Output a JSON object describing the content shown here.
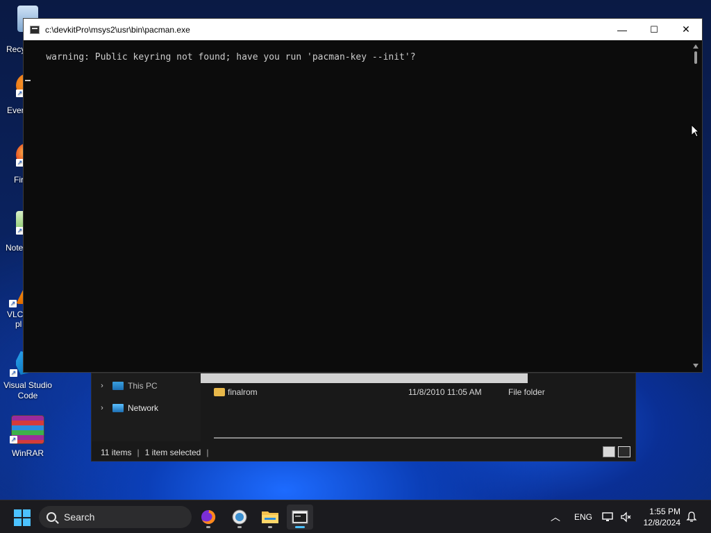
{
  "desktop": {
    "icons": [
      {
        "label": "Recy",
        "icon": "recycle-bin-icon"
      },
      {
        "label": "Ever",
        "icon": "everything-icon"
      },
      {
        "label": "Fir",
        "icon": "firefox-icon"
      },
      {
        "label": "Note",
        "icon": "notepad-plus-plus-icon"
      },
      {
        "label": "VLC",
        "label2": "pl",
        "icon": "vlc-icon"
      },
      {
        "label": "Visual Studio",
        "label2": "Code",
        "icon": "vscode-icon"
      },
      {
        "label": "WinRAR",
        "icon": "winrar-icon"
      }
    ]
  },
  "console": {
    "title": "c:\\devkitPro\\msys2\\usr\\bin\\pacman.exe",
    "line1": "warning: Public keyring not found; have you run 'pacman-key --init'?",
    "buttons": {
      "minimize": "—",
      "maximize": "☐",
      "close": "✕"
    }
  },
  "explorer": {
    "nav": [
      {
        "label": "This PC",
        "icon": "this-pc-icon"
      },
      {
        "label": "Network",
        "icon": "network-icon"
      }
    ],
    "file": {
      "name": "finalrom",
      "date": "11/8/2010 11:05 AM",
      "type": "File folder"
    },
    "status": {
      "items": "11 items",
      "selected": "1 item selected"
    }
  },
  "taskbar": {
    "search_placeholder": "Search",
    "apps": [
      "firefox-icon",
      "devkitpro-updater-icon",
      "file-explorer-icon",
      "terminal-icon"
    ],
    "tray": {
      "language": "ENG",
      "time": "1:55 PM",
      "date": "12/8/2024"
    }
  },
  "colors": {
    "accent": "#4cc2ff",
    "console_bg": "#0c0c0c",
    "console_text": "#cccccc"
  }
}
